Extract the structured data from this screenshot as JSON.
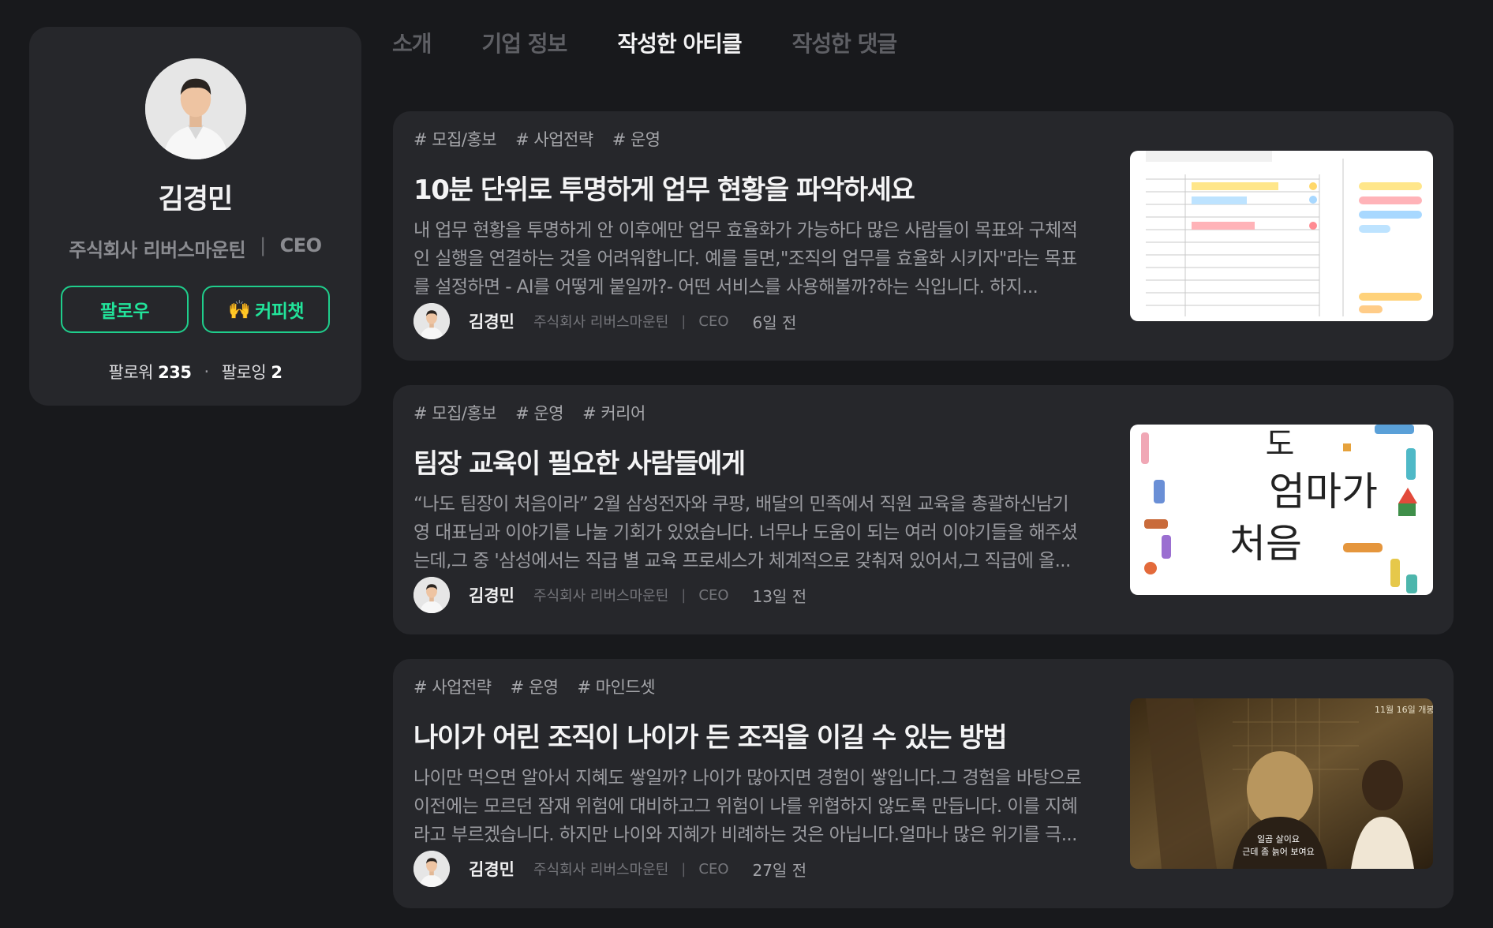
{
  "profile": {
    "name": "김경민",
    "company": "주식회사 리버스마운틴",
    "separator": "|",
    "role": "CEO",
    "follow_label": "팔로우",
    "coffeechat_emoji": "🙌",
    "coffeechat_label": "커피챗",
    "followers_label": "팔로워",
    "followers_count": "235",
    "following_label": "팔로잉",
    "following_count": "2",
    "dot": "·"
  },
  "tabs": [
    {
      "label": "소개",
      "active": false
    },
    {
      "label": "기업 정보",
      "active": false
    },
    {
      "label": "작성한 아티클",
      "active": true
    },
    {
      "label": "작성한 댓글",
      "active": false
    }
  ],
  "articles": [
    {
      "tags": [
        "# 모집/홍보",
        "# 사업전략",
        "# 운영"
      ],
      "title": "10분 단위로 투명하게 업무 현황을 파악하세요",
      "excerpt": "내 업무 현황을 투명하게 안 이후에만 업무 효율화가 가능하다 많은 사람들이 목표와 구체적인 실행을 연결하는 것을 어려워합니다. 예를 들면,\"조직의 업무를 효율화 시키자\"라는 목표를 설정하면 - AI를 어떻게 붙일까?- 어떤 서비스를 사용해볼까?하는 식입니다. 하지...",
      "author": "김경민",
      "company": "주식회사 리버스마운틴",
      "separator": "|",
      "role": "CEO",
      "time": "6일 전"
    },
    {
      "tags": [
        "# 모집/홍보",
        "# 운영",
        "# 커리어"
      ],
      "title": "팀장 교육이 필요한 사람들에게",
      "excerpt": "“나도 팀장이 처음이라” 2월 삼성전자와 쿠팡, 배달의 민족에서 직원 교육을 총괄하신남기영 대표님과 이야기를 나눌 기회가 있었습니다. 너무나 도움이 되는 여러 이야기들을 해주셨는데,그 중 '삼성에서는 직급 별 교육 프로세스가 체계적으로 갖춰져 있어서,그 직급에 올...",
      "author": "김경민",
      "company": "주식회사 리버스마운틴",
      "separator": "|",
      "role": "CEO",
      "time": "13일 전",
      "thumb_text": [
        "도",
        "엄마가",
        "처음"
      ]
    },
    {
      "tags": [
        "# 사업전략",
        "# 운영",
        "# 마인드셋"
      ],
      "title": "나이가 어린 조직이 나이가 든 조직을 이길 수 있는 방법",
      "excerpt": "나이만 먹으면 알아서 지혜도 쌓일까? 나이가 많아지면 경험이 쌓입니다.그 경험을 바탕으로 이전에는 모르던 잠재 위험에 대비하고그 위험이 나를 위협하지 않도록 만듭니다. 이를 지혜라고 부르겠습니다. 하지만 나이와 지혜가 비례하는 것은 아닙니다.얼마나 많은 위기를 극...",
      "author": "김경민",
      "company": "주식회사 리버스마운틴",
      "separator": "|",
      "role": "CEO",
      "time": "27일 전",
      "thumb_text": [
        "11월 16일 개봉",
        "일곱 살이요",
        "근데 좀 늙어 보여요"
      ]
    }
  ]
}
